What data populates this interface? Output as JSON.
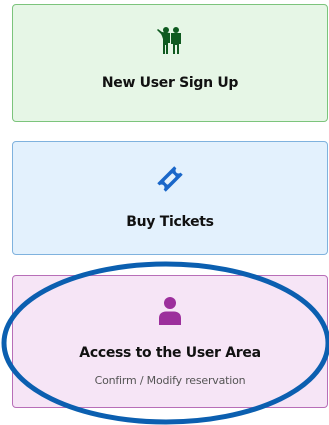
{
  "cards": {
    "signup": {
      "label": "New User Sign Up",
      "icon": "people-icon",
      "color": "#0f5a20"
    },
    "tickets": {
      "label": "Buy Tickets",
      "icon": "ticket-icon",
      "color": "#1a67c9"
    },
    "user_area": {
      "label": "Access to the User Area",
      "sublabel": "Confirm / Modify reservation",
      "icon": "user-icon",
      "color": "#9c2f9c"
    }
  },
  "annotation": {
    "type": "ellipse-highlight",
    "color": "#0b5fb0"
  }
}
